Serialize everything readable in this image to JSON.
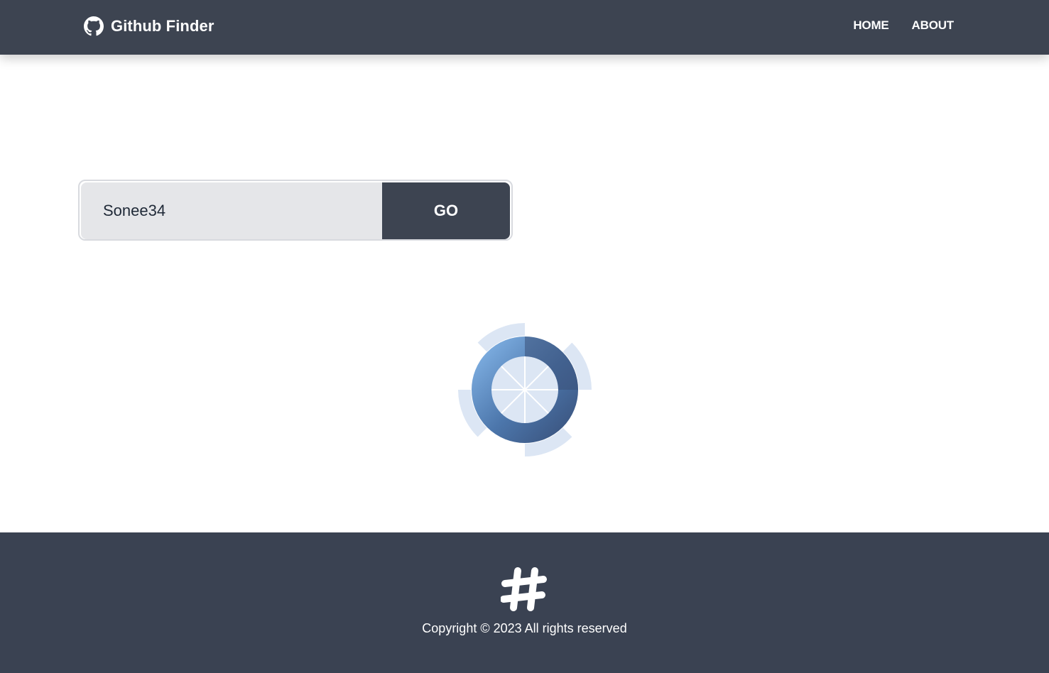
{
  "navbar": {
    "brand_title": "Github Finder",
    "brand_icon": "github-icon",
    "links": [
      {
        "label": "HOME"
      },
      {
        "label": "ABOUT"
      }
    ]
  },
  "search": {
    "value": "Sonee34",
    "placeholder": "Search",
    "button_label": "GO"
  },
  "loader": {
    "icon": "loading-spinner-icon"
  },
  "footer": {
    "icon": "hashtag-icon",
    "copyright": "Copyright © 2023 All rights reserved"
  },
  "colors": {
    "navbar_bg": "#3d4451",
    "footer_bg": "#3a4252",
    "input_bg": "#e5e6e9",
    "spinner_light": "#dce6f4",
    "spinner_dark": "#3f5a84"
  }
}
